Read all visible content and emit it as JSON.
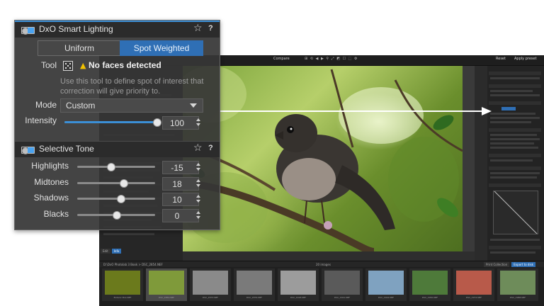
{
  "app": {
    "toolbar": {
      "compare_label": "Compare",
      "reset_label": "Reset",
      "apply_label": "Apply preset"
    },
    "left_tabs": [
      "Edit",
      "Info"
    ],
    "filmstrip": {
      "path": "D:\\DxO Photolab 3 Book > DSC_2854.NEF",
      "count": "20 images",
      "buttons": [
        "Print Collection",
        "Export to disk"
      ],
      "thumbnails": [
        {
          "caption": "Botanic Box.NEF",
          "color": "#6b7a1c"
        },
        {
          "caption": "DSC_2854.NEF",
          "color": "#7f9a3a",
          "selected": true
        },
        {
          "caption": "DSC_2873.NEF",
          "color": "#8a8a8a"
        },
        {
          "caption": "DSC_2879.NEF",
          "color": "#7a7a7a"
        },
        {
          "caption": "DSC_2918.NEF",
          "color": "#9c9c9c"
        },
        {
          "caption": "DSC_2921.NEF",
          "color": "#5a5a5a"
        },
        {
          "caption": "DSC_2944.NEF",
          "color": "#7fa2c0"
        },
        {
          "caption": "DSC_2950.NEF",
          "color": "#4e7a3a"
        },
        {
          "caption": "DSC_2972.NEF",
          "color": "#b85a4a"
        },
        {
          "caption": "DSC_2988.NEF",
          "color": "#6e8c5a"
        }
      ]
    }
  },
  "overlay": {
    "smart_lighting": {
      "title": "DxO Smart Lighting",
      "modes": [
        "Uniform",
        "Spot Weighted"
      ],
      "active_mode": "Spot Weighted",
      "tool_label": "Tool",
      "warning": "No faces detected",
      "note": "Use this tool to define spot of interest that correction will give priority to.",
      "mode_label": "Mode",
      "mode_value": "Custom",
      "intensity_label": "Intensity",
      "intensity_value": "100",
      "intensity_fraction": 1.0
    },
    "selective_tone": {
      "title": "Selective Tone",
      "rows": [
        {
          "label": "Highlights",
          "value": "-15",
          "fraction": 0.43
        },
        {
          "label": "Midtones",
          "value": "18",
          "fraction": 0.59
        },
        {
          "label": "Shadows",
          "value": "10",
          "fraction": 0.55
        },
        {
          "label": "Blacks",
          "value": "0",
          "fraction": 0.5
        }
      ]
    }
  }
}
